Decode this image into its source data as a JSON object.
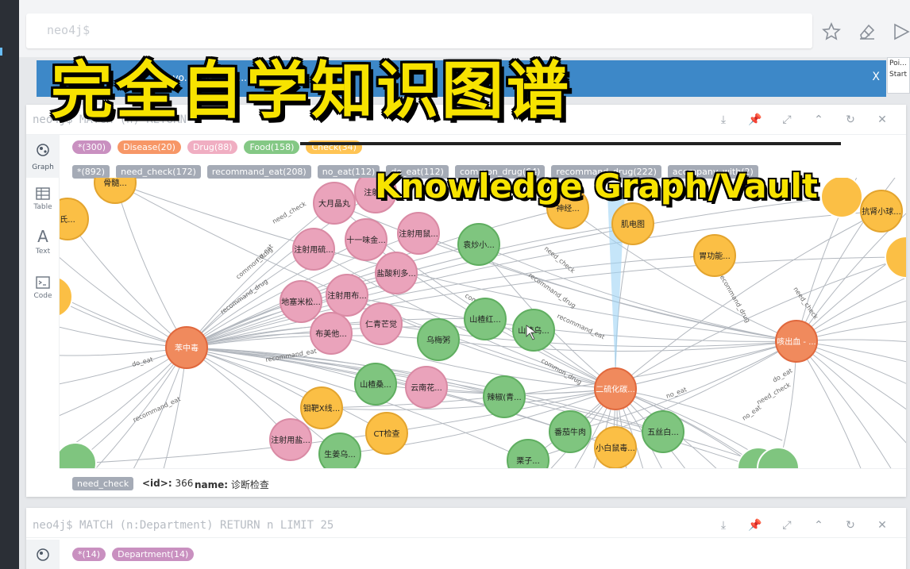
{
  "editor": {
    "prompt": "neo4j$"
  },
  "banner": {
    "message": "To ... ll No... ...en... ...ise yo... ...N... ...y...",
    "close": "X"
  },
  "side_tip": {
    "line1": "Poi...",
    "line2": "Start"
  },
  "frame1": {
    "query_prompt": "neo4j$",
    "query": "MATCH (n) RETURN n",
    "tabs": [
      {
        "label": "Graph"
      },
      {
        "label": "Table"
      },
      {
        "label": "Text"
      },
      {
        "label": "Code"
      }
    ],
    "node_labels": [
      {
        "text": "*(300)",
        "color": "#c990c0"
      },
      {
        "text": "Disease(20)",
        "color": "#f79767"
      },
      {
        "text": "Drug(88)",
        "color": "#f0aec2"
      },
      {
        "text": "Food(158)",
        "color": "#84c885"
      },
      {
        "text": "Check(34)",
        "color": "#ffc454"
      }
    ],
    "rel_types": [
      "*(892)",
      "need_check(172)",
      "recommand_eat(208)",
      "no_eat(112)",
      "do_eat(112)",
      "common_drug(64)",
      "recommand_drug(222)",
      "acompany_with(2)"
    ],
    "graph": {
      "node_colors": {
        "disease": "#f08a5d",
        "drug": "#eaa3bb",
        "food": "#7fc57f",
        "check": "#fbbf45"
      },
      "nodes": [
        {
          "id": "a",
          "text": "苯中毒",
          "type": "disease"
        },
        {
          "id": "b",
          "text": "二硫化碳...",
          "type": "disease"
        },
        {
          "id": "c",
          "text": "咳出血 - ...",
          "type": "disease"
        },
        {
          "id": "d",
          "text": "大月晶丸",
          "type": "drug"
        },
        {
          "id": "e",
          "text": "注射...",
          "type": "drug"
        },
        {
          "id": "f",
          "text": "十一味金...",
          "type": "drug"
        },
        {
          "id": "g",
          "text": "注射用鼠...",
          "type": "drug"
        },
        {
          "id": "h",
          "text": "注射用硫...",
          "type": "drug"
        },
        {
          "id": "i",
          "text": "盐酸利多...",
          "type": "drug"
        },
        {
          "id": "j",
          "text": "注射用布...",
          "type": "drug"
        },
        {
          "id": "k",
          "text": "地塞米松...",
          "type": "drug"
        },
        {
          "id": "l",
          "text": "布美他...",
          "type": "drug"
        },
        {
          "id": "m",
          "text": "仁青芒觉",
          "type": "drug"
        },
        {
          "id": "n",
          "text": "云南花...",
          "type": "drug"
        },
        {
          "id": "o",
          "text": "注射用盐...",
          "type": "drug"
        },
        {
          "id": "p",
          "text": "袁炒小...",
          "type": "food"
        },
        {
          "id": "q",
          "text": "山楂红...",
          "type": "food"
        },
        {
          "id": "r",
          "text": "山楂乌...",
          "type": "food"
        },
        {
          "id": "s",
          "text": "乌梅粥",
          "type": "food"
        },
        {
          "id": "t",
          "text": "山楂桑...",
          "type": "food"
        },
        {
          "id": "u",
          "text": "辣椒(青...",
          "type": "food"
        },
        {
          "id": "v",
          "text": "番茄牛肉",
          "type": "food"
        },
        {
          "id": "w",
          "text": "五丝白...",
          "type": "food"
        },
        {
          "id": "x",
          "text": "生姜乌...",
          "type": "food"
        },
        {
          "id": "y",
          "text": "栗子...",
          "type": "food"
        },
        {
          "id": "z",
          "text": "肌电图",
          "type": "check"
        },
        {
          "id": "aa",
          "text": "胃功能...",
          "type": "check"
        },
        {
          "id": "ab",
          "text": "钼靶X线...",
          "type": "check"
        },
        {
          "id": "ac",
          "text": "CT检查",
          "type": "check"
        },
        {
          "id": "ad",
          "text": "小白鼠毒...",
          "type": "check"
        },
        {
          "id": "ae",
          "text": "神经...",
          "type": "check"
        },
        {
          "id": "af",
          "text": "抗肾小球...",
          "type": "check"
        },
        {
          "id": "ag",
          "text": "氏...",
          "type": "check"
        },
        {
          "id": "ah",
          "text": "骨髓...",
          "type": "check"
        }
      ],
      "edge_labels": [
        "recommand_drug",
        "common_drug",
        "no_eat",
        "do_eat",
        "recommand_eat",
        "need_check",
        "recommand_drug",
        "common_drug",
        "recommand_eat",
        "no_eat",
        "need_check",
        "need_check",
        "do_eat",
        "no_eat",
        "recommand_eat",
        "need_check",
        "common_drug",
        "recommand_drug"
      ]
    },
    "status": {
      "tag": "need_check",
      "id_key": "<id>:",
      "id_val": "366",
      "name_key": "name:",
      "name_val": "诊断检查"
    }
  },
  "frame2": {
    "query_prompt": "neo4j$",
    "query": "MATCH (n:Department) RETURN n LIMIT 25",
    "node_labels": [
      {
        "text": "*(14)",
        "color": "#c990c0"
      },
      {
        "text": "Department(14)",
        "color": "#c990c0"
      }
    ]
  },
  "overlay": {
    "title": "完全自学知识图谱",
    "subtitle": "Knowledge Graph/Vault"
  }
}
